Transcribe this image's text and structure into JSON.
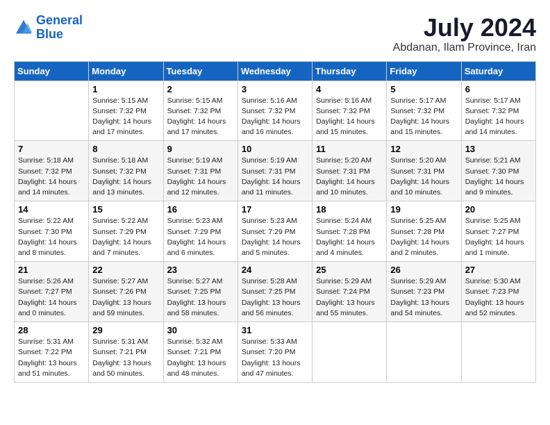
{
  "logo": {
    "line1": "General",
    "line2": "Blue"
  },
  "title": "July 2024",
  "location": "Abdanan, Ilam Province, Iran",
  "weekdays": [
    "Sunday",
    "Monday",
    "Tuesday",
    "Wednesday",
    "Thursday",
    "Friday",
    "Saturday"
  ],
  "weeks": [
    [
      {
        "day": "",
        "info": ""
      },
      {
        "day": "1",
        "info": "Sunrise: 5:15 AM\nSunset: 7:32 PM\nDaylight: 14 hours\nand 17 minutes."
      },
      {
        "day": "2",
        "info": "Sunrise: 5:15 AM\nSunset: 7:32 PM\nDaylight: 14 hours\nand 17 minutes."
      },
      {
        "day": "3",
        "info": "Sunrise: 5:16 AM\nSunset: 7:32 PM\nDaylight: 14 hours\nand 16 minutes."
      },
      {
        "day": "4",
        "info": "Sunrise: 5:16 AM\nSunset: 7:32 PM\nDaylight: 14 hours\nand 15 minutes."
      },
      {
        "day": "5",
        "info": "Sunrise: 5:17 AM\nSunset: 7:32 PM\nDaylight: 14 hours\nand 15 minutes."
      },
      {
        "day": "6",
        "info": "Sunrise: 5:17 AM\nSunset: 7:32 PM\nDaylight: 14 hours\nand 14 minutes."
      }
    ],
    [
      {
        "day": "7",
        "info": "Sunrise: 5:18 AM\nSunset: 7:32 PM\nDaylight: 14 hours\nand 14 minutes."
      },
      {
        "day": "8",
        "info": "Sunrise: 5:18 AM\nSunset: 7:32 PM\nDaylight: 14 hours\nand 13 minutes."
      },
      {
        "day": "9",
        "info": "Sunrise: 5:19 AM\nSunset: 7:31 PM\nDaylight: 14 hours\nand 12 minutes."
      },
      {
        "day": "10",
        "info": "Sunrise: 5:19 AM\nSunset: 7:31 PM\nDaylight: 14 hours\nand 11 minutes."
      },
      {
        "day": "11",
        "info": "Sunrise: 5:20 AM\nSunset: 7:31 PM\nDaylight: 14 hours\nand 10 minutes."
      },
      {
        "day": "12",
        "info": "Sunrise: 5:20 AM\nSunset: 7:31 PM\nDaylight: 14 hours\nand 10 minutes."
      },
      {
        "day": "13",
        "info": "Sunrise: 5:21 AM\nSunset: 7:30 PM\nDaylight: 14 hours\nand 9 minutes."
      }
    ],
    [
      {
        "day": "14",
        "info": "Sunrise: 5:22 AM\nSunset: 7:30 PM\nDaylight: 14 hours\nand 8 minutes."
      },
      {
        "day": "15",
        "info": "Sunrise: 5:22 AM\nSunset: 7:29 PM\nDaylight: 14 hours\nand 7 minutes."
      },
      {
        "day": "16",
        "info": "Sunrise: 5:23 AM\nSunset: 7:29 PM\nDaylight: 14 hours\nand 6 minutes."
      },
      {
        "day": "17",
        "info": "Sunrise: 5:23 AM\nSunset: 7:29 PM\nDaylight: 14 hours\nand 5 minutes."
      },
      {
        "day": "18",
        "info": "Sunrise: 5:24 AM\nSunset: 7:28 PM\nDaylight: 14 hours\nand 4 minutes."
      },
      {
        "day": "19",
        "info": "Sunrise: 5:25 AM\nSunset: 7:28 PM\nDaylight: 14 hours\nand 2 minutes."
      },
      {
        "day": "20",
        "info": "Sunrise: 5:25 AM\nSunset: 7:27 PM\nDaylight: 14 hours\nand 1 minute."
      }
    ],
    [
      {
        "day": "21",
        "info": "Sunrise: 5:26 AM\nSunset: 7:27 PM\nDaylight: 14 hours\nand 0 minutes."
      },
      {
        "day": "22",
        "info": "Sunrise: 5:27 AM\nSunset: 7:26 PM\nDaylight: 13 hours\nand 59 minutes."
      },
      {
        "day": "23",
        "info": "Sunrise: 5:27 AM\nSunset: 7:25 PM\nDaylight: 13 hours\nand 58 minutes."
      },
      {
        "day": "24",
        "info": "Sunrise: 5:28 AM\nSunset: 7:25 PM\nDaylight: 13 hours\nand 56 minutes."
      },
      {
        "day": "25",
        "info": "Sunrise: 5:29 AM\nSunset: 7:24 PM\nDaylight: 13 hours\nand 55 minutes."
      },
      {
        "day": "26",
        "info": "Sunrise: 5:29 AM\nSunset: 7:23 PM\nDaylight: 13 hours\nand 54 minutes."
      },
      {
        "day": "27",
        "info": "Sunrise: 5:30 AM\nSunset: 7:23 PM\nDaylight: 13 hours\nand 52 minutes."
      }
    ],
    [
      {
        "day": "28",
        "info": "Sunrise: 5:31 AM\nSunset: 7:22 PM\nDaylight: 13 hours\nand 51 minutes."
      },
      {
        "day": "29",
        "info": "Sunrise: 5:31 AM\nSunset: 7:21 PM\nDaylight: 13 hours\nand 50 minutes."
      },
      {
        "day": "30",
        "info": "Sunrise: 5:32 AM\nSunset: 7:21 PM\nDaylight: 13 hours\nand 48 minutes."
      },
      {
        "day": "31",
        "info": "Sunrise: 5:33 AM\nSunset: 7:20 PM\nDaylight: 13 hours\nand 47 minutes."
      },
      {
        "day": "",
        "info": ""
      },
      {
        "day": "",
        "info": ""
      },
      {
        "day": "",
        "info": ""
      }
    ]
  ]
}
